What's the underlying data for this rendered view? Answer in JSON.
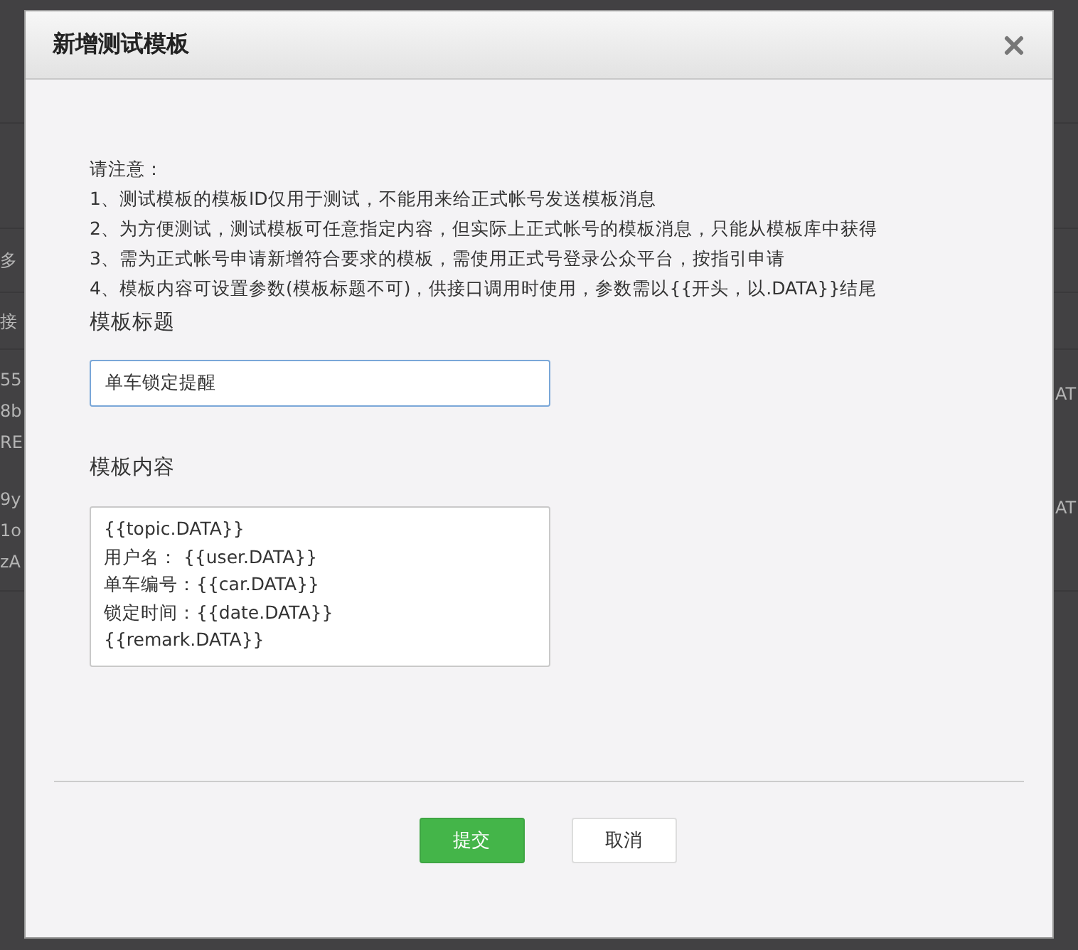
{
  "background": {
    "left_fragments": [
      "多",
      "接",
      "55",
      "8b",
      "RE",
      "9y",
      "1o",
      "zA"
    ],
    "right_fragments": [
      "AT",
      "AT"
    ]
  },
  "dialog": {
    "title": "新增测试模板",
    "notes": [
      "请注意：",
      "1、测试模板的模板ID仅用于测试，不能用来给正式帐号发送模板消息",
      "2、为方便测试，测试模板可任意指定内容，但实际上正式帐号的模板消息，只能从模板库中获得",
      "3、需为正式帐号申请新增符合要求的模板，需使用正式号登录公众平台，按指引申请",
      "4、模板内容可设置参数(模板标题不可)，供接口调用时使用，参数需以{{开头，以.DATA}}结尾"
    ],
    "title_field": {
      "label": "模板标题",
      "value": "单车锁定提醒"
    },
    "content_field": {
      "label": "模板内容",
      "lines": [
        "{{topic.DATA}}",
        "用户名： {{user.DATA}}",
        "单车编号：{{car.DATA}}",
        "锁定时间：{{date.DATA}}",
        "{{remark.DATA}}"
      ]
    },
    "buttons": [
      {
        "label": "提交",
        "kind": "primary"
      },
      {
        "label": "取消",
        "kind": "default"
      }
    ]
  }
}
